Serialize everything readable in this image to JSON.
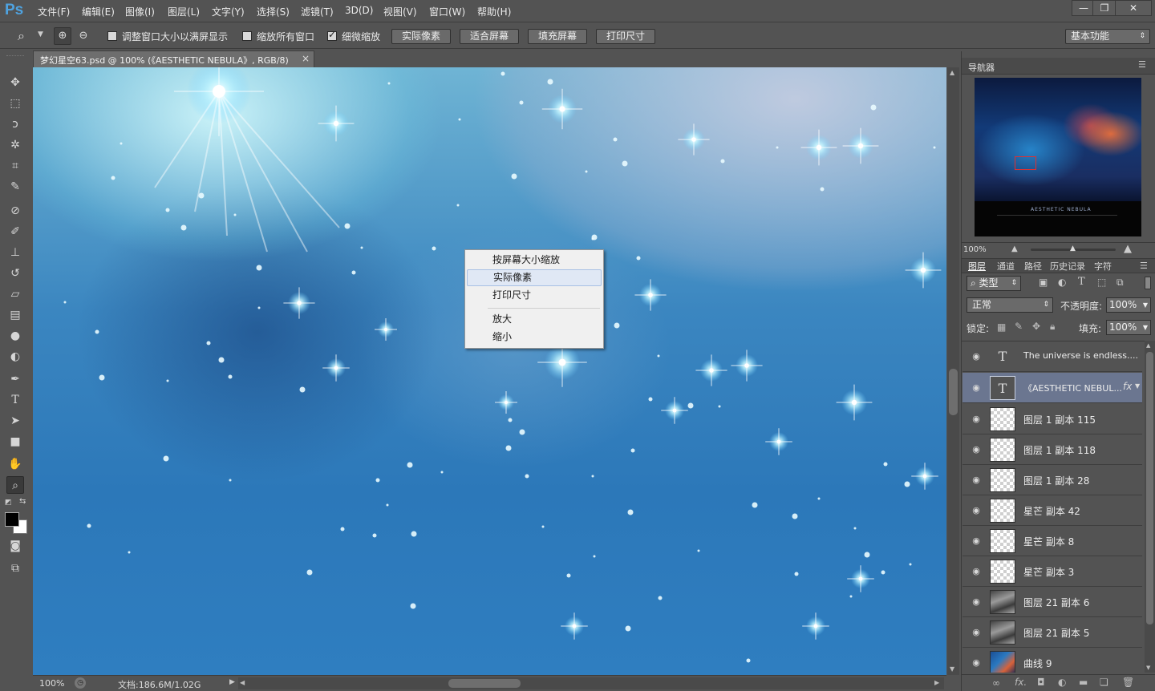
{
  "app": {
    "logo": "Ps"
  },
  "menu": [
    "文件(F)",
    "编辑(E)",
    "图像(I)",
    "图层(L)",
    "文字(Y)",
    "选择(S)",
    "滤镜(T)",
    "3D(D)",
    "视图(V)",
    "窗口(W)",
    "帮助(H)"
  ],
  "window_controls": {
    "minimize": "—",
    "restore": "❐",
    "close": "✕"
  },
  "options": {
    "resize_windows_label": "调整窗口大小以满屏显示",
    "resize_windows_checked": false,
    "zoom_all_label": "缩放所有窗口",
    "zoom_all_checked": false,
    "scrubby_zoom_label": "细微缩放",
    "scrubby_zoom_checked": true,
    "btn_actual_pixels": "实际像素",
    "btn_fit_screen": "适合屏幕",
    "btn_fill_screen": "填充屏幕",
    "btn_print_size": "打印尺寸",
    "workspace": "基本功能"
  },
  "document": {
    "tab_title": "梦幻星空63.psd @ 100% (《AESTHETIC  NEBULA》, RGB/8)",
    "close_glyph": "×",
    "zoom": "100%",
    "doc_size": "文档:186.6M/1.02G"
  },
  "context_menu": {
    "items": [
      "按屏幕大小缩放",
      "实际像素",
      "打印尺寸",
      "放大",
      "缩小"
    ],
    "highlighted": "实际像素"
  },
  "navigator": {
    "title": "导航器",
    "zoom": "100%",
    "thumb_caption": "AESTHETIC NEBULA"
  },
  "layers_panel": {
    "tabs": [
      "图层",
      "通道",
      "路径",
      "历史记录",
      "字符"
    ],
    "filter": "类型",
    "blend_mode": "正常",
    "opacity_label": "不透明度:",
    "opacity": "100%",
    "lock_label": "锁定:",
    "fill_label": "填充:",
    "fill": "100%",
    "fx": "fx",
    "layers": [
      {
        "name": "The universe is endless....",
        "kind": "text",
        "selected": false
      },
      {
        "name": "《AESTHETIC NEBUL...",
        "kind": "text",
        "selected": true
      },
      {
        "name": "图层 1 副本 115",
        "kind": "pixel",
        "selected": false
      },
      {
        "name": "图层 1 副本 118",
        "kind": "pixel",
        "selected": false
      },
      {
        "name": "图层 1 副本 28",
        "kind": "pixel",
        "selected": false
      },
      {
        "name": "星芒 副本 42",
        "kind": "pixel",
        "selected": false
      },
      {
        "name": "星芒 副本 8",
        "kind": "pixel",
        "selected": false
      },
      {
        "name": "星芒 副本 3",
        "kind": "pixel",
        "selected": false
      },
      {
        "name": "图层 21 副本 6",
        "kind": "cloud",
        "selected": false
      },
      {
        "name": "图层 21 副本 5",
        "kind": "cloud",
        "selected": false
      },
      {
        "name": "曲线 9",
        "kind": "curve",
        "selected": false
      }
    ]
  },
  "tools": [
    "move-tool",
    "marquee-tool",
    "lasso-tool",
    "magic-wand-tool",
    "crop-tool",
    "eyedropper-tool",
    "healing-brush-tool",
    "brush-tool",
    "clone-stamp-tool",
    "history-brush-tool",
    "eraser-tool",
    "gradient-tool",
    "blur-tool",
    "dodge-tool",
    "pen-tool",
    "type-tool",
    "path-selection-tool",
    "rectangle-tool",
    "hand-tool",
    "zoom-tool"
  ],
  "colors": {
    "foreground": "#000000",
    "background": "#ffffff",
    "ps_blue": "#4fa3e0",
    "selected_layer": "#6b7690"
  }
}
